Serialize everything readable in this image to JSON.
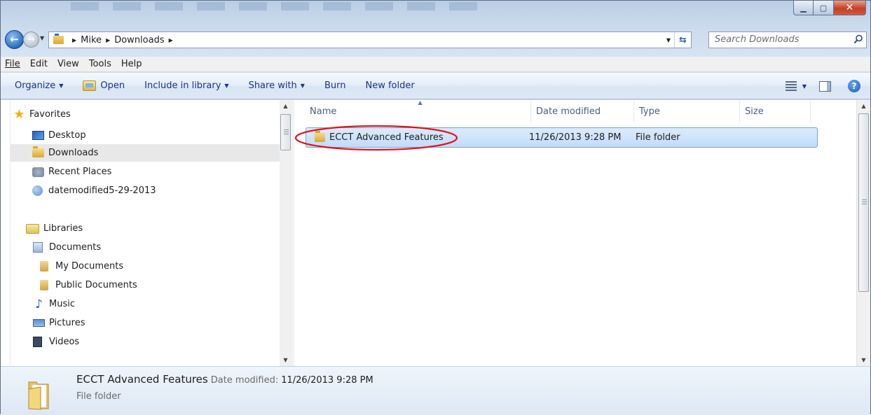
{
  "window": {
    "caption_buttons": [
      "minimize",
      "maximize",
      "close"
    ]
  },
  "address": {
    "crumbs": [
      "Mike",
      "Downloads"
    ]
  },
  "search": {
    "placeholder": "Search Downloads"
  },
  "menu": {
    "items": [
      {
        "label": "File",
        "accel": "F"
      },
      {
        "label": "Edit",
        "accel": "E"
      },
      {
        "label": "View",
        "accel": "V"
      },
      {
        "label": "Tools",
        "accel": "T"
      },
      {
        "label": "Help",
        "accel": "H"
      }
    ]
  },
  "toolbar": {
    "organize": "Organize",
    "open": "Open",
    "include_in_library": "Include in library",
    "share_with": "Share with",
    "burn": "Burn",
    "new_folder": "New folder"
  },
  "nav": {
    "favorites": "Favorites",
    "desktop": "Desktop",
    "downloads": "Downloads",
    "recent_places": "Recent Places",
    "saved_search": "datemodified5-29-2013",
    "libraries": "Libraries",
    "documents": "Documents",
    "my_documents": "My Documents",
    "public_documents": "Public Documents",
    "music": "Music",
    "pictures": "Pictures",
    "videos": "Videos"
  },
  "columns": {
    "name": "Name",
    "date_modified": "Date modified",
    "type": "Type",
    "size": "Size"
  },
  "files": [
    {
      "name": "ECCT Advanced Features",
      "date_modified": "11/26/2013 9:28 PM",
      "type": "File folder",
      "size": ""
    }
  ],
  "details": {
    "name": "ECCT Advanced Features",
    "date_label": "Date modified:",
    "date_value": "11/26/2013 9:28 PM",
    "type": "File folder"
  },
  "colors": {
    "selection_fill": "#c2dcf8",
    "selection_border": "#7da2ce",
    "annotation_circle": "#e0141e",
    "command_text": "#1e3287"
  }
}
